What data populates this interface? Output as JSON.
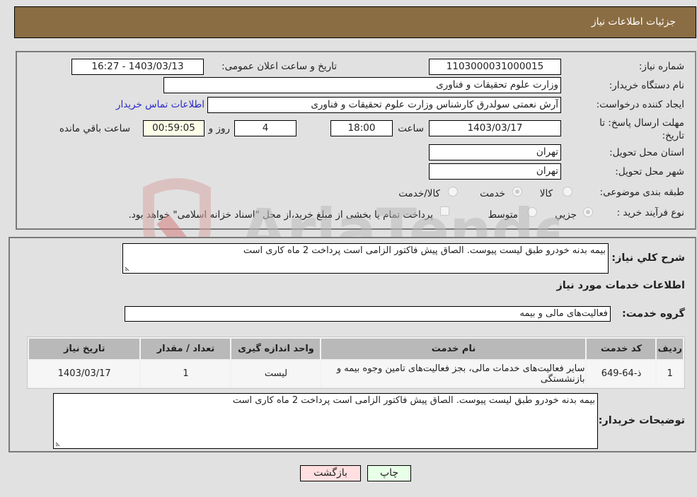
{
  "header": {
    "title": "جزئیات اطلاعات نیاز"
  },
  "form": {
    "need_number": {
      "label": "شماره نیاز:",
      "value": "1103000031000015"
    },
    "announce_datetime": {
      "label": "تاریخ و ساعت اعلان عمومی:",
      "value": "1403/03/13 - 16:27"
    },
    "buyer_org": {
      "label": "نام دستگاه خریدار:",
      "value": "وزارت علوم  تحقیقات و فناوری"
    },
    "requester": {
      "label": "ایجاد کننده درخواست:",
      "value": "آرش نعمتی سولدرق کارشناس وزارت علوم  تحقیقات و فناوری",
      "contact_link": "اطلاعات تماس خریدار"
    },
    "deadline": {
      "label_line1": "مهلت ارسال پاسخ: تا",
      "label_line2": "تاریخ:",
      "date": "1403/03/17",
      "time_label": "ساعت",
      "time": "18:00",
      "days": "4",
      "days_label": "روز و",
      "remaining": "00:59:05",
      "remaining_label": "ساعت باقي مانده"
    },
    "province": {
      "label": "استان محل تحویل:",
      "value": "تهران"
    },
    "city": {
      "label": "شهر محل تحویل:",
      "value": "تهران"
    },
    "category": {
      "label": "طبقه بندی موضوعی:",
      "options": [
        "کالا",
        "خدمت",
        "کالا/خدمت"
      ],
      "selected": "خدمت"
    },
    "purchase_type": {
      "label": "نوع فرآیند خرید :",
      "options": [
        "جزيي",
        "متوسط"
      ],
      "selected": "جزيي",
      "treasury_note": "پرداخت تمام یا بخشی از مبلغ خرید،از محل \"اسناد خزانه اسلامی\" خواهد بود."
    }
  },
  "details": {
    "description_label": "شرح كلي نياز:",
    "description": "بیمه بدنه خودرو طبق لیست پیوست. الصاق پیش فاکتور الزامی است پرداخت 2 ماه کاری است",
    "services_heading": "اطلاعات خدمات مورد نیاز",
    "service_group_label": "گروه خدمت:",
    "service_group": "فعالیت‌های مالی و بیمه",
    "table": {
      "headers": [
        "ردیف",
        "کد خدمت",
        "نام خدمت",
        "واحد اندازه گیری",
        "تعداد / مقدار",
        "تاریخ نیاز"
      ],
      "rows": [
        [
          "1",
          "ذ-64-649",
          "سایر فعالیت‌های خدمات مالی، بجز فعالیت‌های تامین وجوه بیمه و بازنشستگی",
          "لیست",
          "1",
          "1403/03/17"
        ]
      ]
    },
    "buyer_notes_label": "توضیحات خریدار:",
    "buyer_notes": "بیمه بدنه خودرو طبق لیست پیوست. الصاق پیش فاکتور الزامی است پرداخت 2 ماه کاری است"
  },
  "buttons": {
    "print": "چاپ",
    "back": "بازگشت"
  },
  "watermark": {
    "text": "AriaTender.neT"
  },
  "colors": {
    "header_bg": "#8b6d43",
    "link": "#2a28c8",
    "back_btn": "#ffdfdf",
    "print_btn": "#e8ffe8"
  }
}
